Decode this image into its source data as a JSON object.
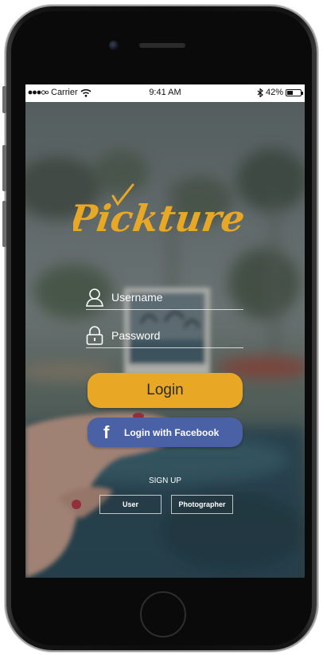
{
  "status_bar": {
    "carrier": "Carrier",
    "time": "9:41 AM",
    "battery": "42%",
    "battery_level": 0.42
  },
  "app": {
    "logo_text": "Pickture"
  },
  "login_form": {
    "username_label": "Username",
    "password_label": "Password"
  },
  "buttons": {
    "login": "Login",
    "facebook_icon_glyph": "f",
    "facebook": "Login with Facebook"
  },
  "signup": {
    "title": "SIGN UP",
    "user": "User",
    "photographer": "Photographer"
  },
  "colors": {
    "accent": "#e9a726",
    "facebook": "#4a61a6",
    "text_light": "#ffffff"
  },
  "icons": [
    "user-icon",
    "lock-icon",
    "facebook-icon",
    "wifi-icon",
    "bluetooth-icon",
    "battery-icon",
    "checkmark-icon"
  ]
}
